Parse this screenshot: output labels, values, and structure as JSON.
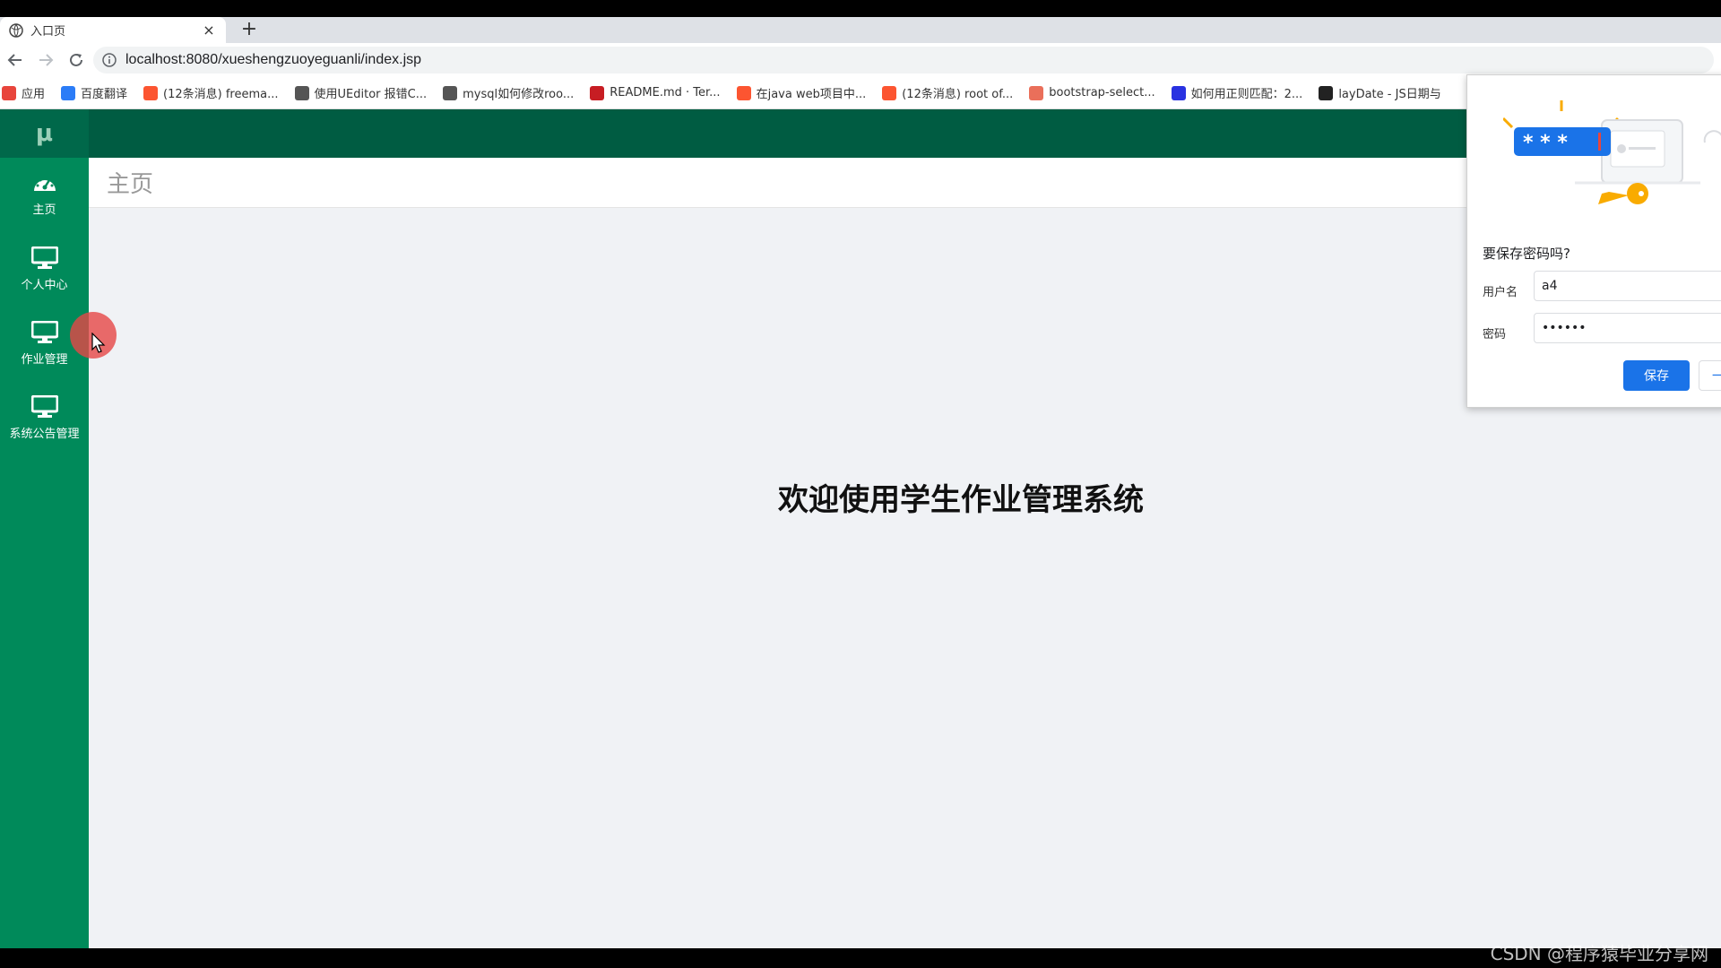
{
  "browser": {
    "tab_title": "入口页",
    "tab_close": "×",
    "new_tab": "+",
    "url": "localhost:8080/xueshengzuoyeguanli/index.jsp",
    "bookmarks": [
      {
        "label": "应用",
        "icon": "apps-grid-icon",
        "color": "#e8453c"
      },
      {
        "label": "百度翻译",
        "icon": "baidu-translate-icon",
        "color": "#2b7cf7"
      },
      {
        "label": "(12条消息) freema...",
        "icon": "csdn-icon",
        "color": "#fc5531"
      },
      {
        "label": "使用UEditor 报错C...",
        "icon": "link-icon",
        "color": "#555555"
      },
      {
        "label": "mysql如何修改roo...",
        "icon": "link-icon",
        "color": "#555555"
      },
      {
        "label": "README.md · Ter...",
        "icon": "gitee-icon",
        "color": "#c71d23"
      },
      {
        "label": "在java web项目中...",
        "icon": "csdn-icon",
        "color": "#fc5531"
      },
      {
        "label": "(12条消息) root of...",
        "icon": "csdn-icon",
        "color": "#fc5531"
      },
      {
        "label": "bootstrap-select...",
        "icon": "jianshu-icon",
        "color": "#ea6f5a"
      },
      {
        "label": "如何用正则匹配：2...",
        "icon": "baidu-paw-icon",
        "color": "#2932e1"
      },
      {
        "label": "layDate - JS日期与",
        "icon": "laydate-icon",
        "color": "#222222"
      }
    ]
  },
  "sidebar": {
    "logo": "μ",
    "items": [
      {
        "label": "主页",
        "icon": "dashboard-icon"
      },
      {
        "label": "个人中心",
        "icon": "monitor-icon"
      },
      {
        "label": "作业管理",
        "icon": "monitor-icon"
      },
      {
        "label": "系统公告管理",
        "icon": "monitor-icon"
      }
    ]
  },
  "page": {
    "title": "主页",
    "welcome": "欢迎使用学生作业管理系统"
  },
  "password_popup": {
    "question": "要保存密码吗?",
    "username_label": "用户名",
    "username_value": "a4",
    "password_label": "密码",
    "password_value": "••••••",
    "save_label": "保存",
    "other_label": "一"
  },
  "watermark": "CSDN @程序猿毕业分享网",
  "colors": {
    "sidebar": "#008a5a",
    "topbar": "#005c42",
    "save_button": "#1a73e8"
  }
}
